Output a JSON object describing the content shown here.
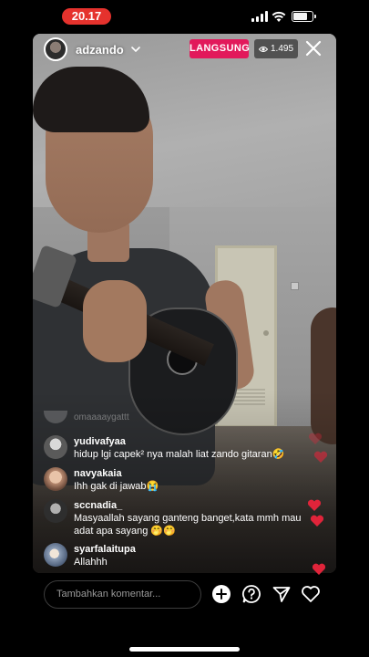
{
  "status_bar": {
    "time": "20.17",
    "battery_level": 0.7
  },
  "live": {
    "host_name": "adzando",
    "badge": "LANGSUNG",
    "viewer_count": "1.495"
  },
  "comments": {
    "faded_user": "omaaaaygattt",
    "items": [
      {
        "user": "yudivafyaa",
        "text": "hidup lgi capek² nya malah liat zando gitaran🤣",
        "avatar_color": "#5a5a5a"
      },
      {
        "user": "navyakaia",
        "text": "Ihh gak di jawab😭",
        "avatar_color": "#c9a28a"
      },
      {
        "user": "sccnadia_",
        "text": "Masyaallah sayang ganteng banget,kata mmh mau adat apa sayang 🤭🤭",
        "avatar_color": "#3a3a3a"
      },
      {
        "user": "syarfalaitupa",
        "text": "Allahhh",
        "avatar_color": "#8fa0b8"
      }
    ]
  },
  "input": {
    "placeholder": "Tambahkan komentar..."
  },
  "icons": {
    "close": "close-icon",
    "chevron": "chevron-down-icon",
    "eye": "eye-icon",
    "add": "plus-circle-icon",
    "question": "question-icon",
    "share": "send-icon",
    "like": "heart-icon"
  },
  "colors": {
    "live_badge": "#e2195b",
    "time_pill": "#e5322d",
    "heart": "#e0243a"
  }
}
